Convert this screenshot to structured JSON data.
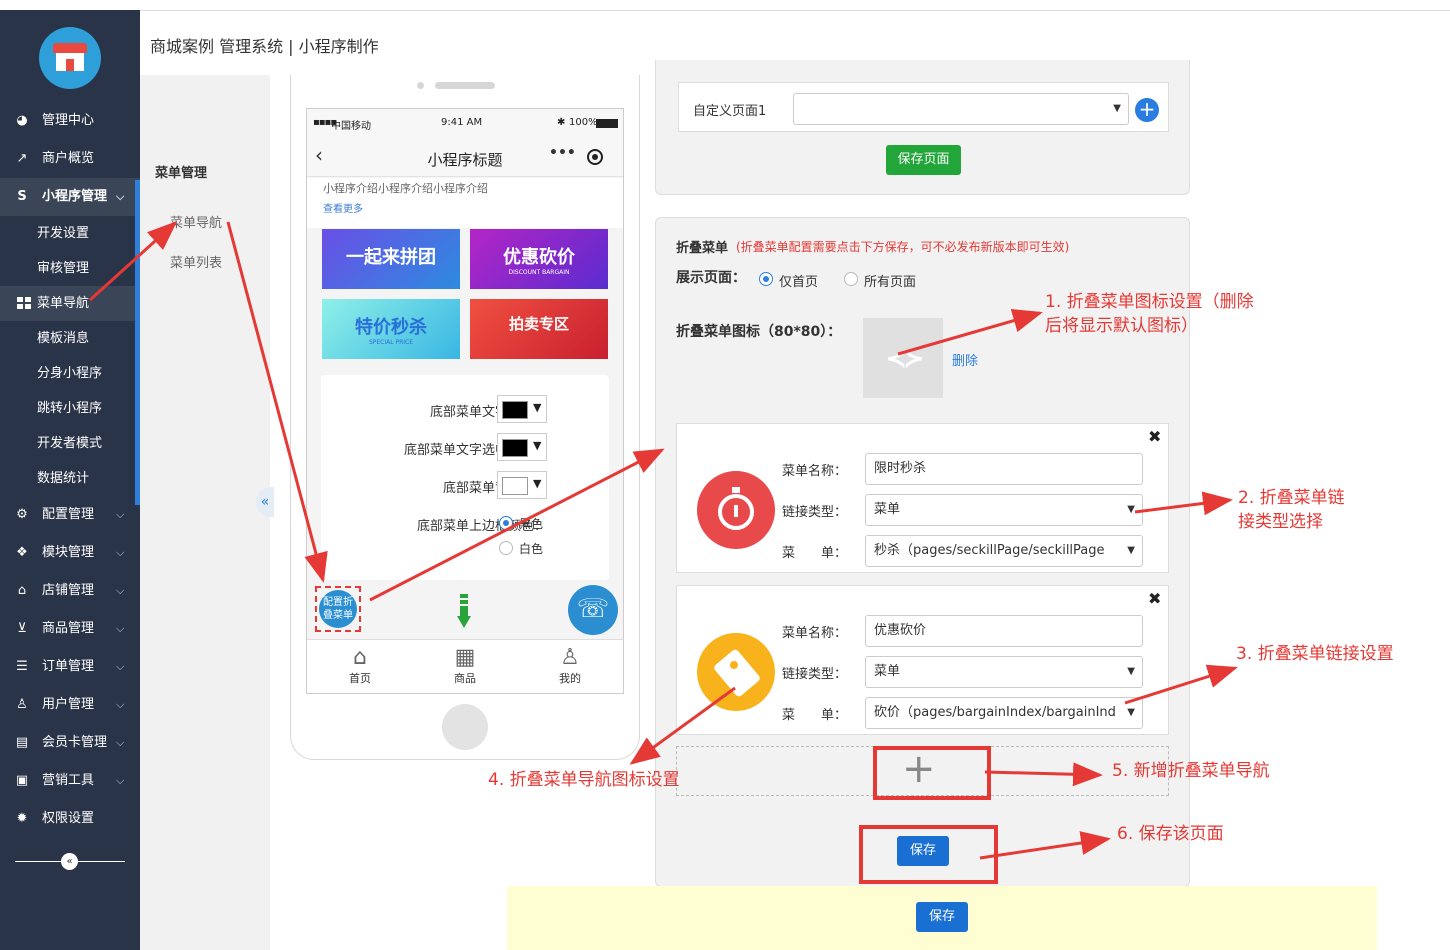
{
  "header": {
    "title": "商城案例 管理系统 | 小程序制作"
  },
  "sidebar": {
    "items": [
      {
        "label": "管理中心",
        "icon": "dashboard-icon",
        "glyph": "◕"
      },
      {
        "label": "商户概览",
        "icon": "chart-icon",
        "glyph": "↗"
      },
      {
        "label": "小程序管理",
        "icon": "dollar-icon",
        "glyph": "S",
        "expanded": true
      },
      {
        "label": "配置管理",
        "icon": "gears-icon",
        "glyph": "⚙"
      },
      {
        "label": "模块管理",
        "icon": "cubes-icon",
        "glyph": "❖"
      },
      {
        "label": "店铺管理",
        "icon": "bank-icon",
        "glyph": "⌂"
      },
      {
        "label": "商品管理",
        "icon": "cart-icon",
        "glyph": "⊻"
      },
      {
        "label": "订单管理",
        "icon": "list-icon",
        "glyph": "☰"
      },
      {
        "label": "用户管理",
        "icon": "user-icon",
        "glyph": "♙"
      },
      {
        "label": "会员卡管理",
        "icon": "card-icon",
        "glyph": "▤"
      },
      {
        "label": "营销工具",
        "icon": "briefcase-icon",
        "glyph": "▣"
      },
      {
        "label": "权限设置",
        "icon": "cog-icon",
        "glyph": "✹"
      }
    ],
    "subitems": [
      "开发设置",
      "审核管理",
      "菜单导航",
      "模板消息",
      "分身小程序",
      "跳转小程序",
      "开发者模式",
      "数据统计"
    ],
    "active_subitem": "菜单导航"
  },
  "subnav": {
    "title": "菜单管理",
    "items": [
      "菜单导航",
      "菜单列表"
    ]
  },
  "phone": {
    "carrier": "中国移动",
    "time": "9:41 AM",
    "battery": "100%",
    "title": "小程序标题",
    "intro": "小程序介绍小程序介绍小程序介绍",
    "more": "查看更多",
    "banners": [
      {
        "text": "一起来拼团",
        "sub": "",
        "color": "#4a5fd8"
      },
      {
        "text": "优惠砍价",
        "sub": "DISCOUNT BARGAIN",
        "color": "#7a2bd0"
      },
      {
        "text": "特价秒杀",
        "sub": "SPECIAL PRICE",
        "color": "#3cc6d8"
      },
      {
        "text": "拍卖专区",
        "sub": "",
        "color": "#e0393b"
      }
    ],
    "color_rows": [
      {
        "label": "底部菜单文字颜色：",
        "color": "#000000"
      },
      {
        "label": "底部菜单文字选中颜色：",
        "color": "#000000"
      },
      {
        "label": "底部菜单背景色：",
        "color": "#ffffff"
      }
    ],
    "border_label": "底部菜单上边框颜色：",
    "border_options": [
      "黑色",
      "白色"
    ],
    "fold_button": "配置折叠菜单",
    "tabs": [
      "首页",
      "商品",
      "我的"
    ]
  },
  "custom_page": {
    "label": "自定义页面1",
    "value": "",
    "save_label": "保存页面"
  },
  "fold_menu": {
    "title": "折叠菜单",
    "note": "(折叠菜单配置需要点击下方保存，可不必发布新版本即可生效)",
    "display_label": "展示页面：",
    "display_options": [
      "仅首页",
      "所有页面"
    ],
    "display_selected": "仅首页",
    "icon_label": "折叠菜单图标（80*80）：",
    "delete_label": "删除",
    "items": [
      {
        "name_label": "菜单名称：",
        "name": "限时秒杀",
        "type_label": "链接类型：",
        "type": "菜单",
        "menu_label": "菜　　单：",
        "menu": "秒杀（pages/seckillPage/seckillPage",
        "icon_color": "#e84a4a"
      },
      {
        "name_label": "菜单名称：",
        "name": "优惠砍价",
        "type_label": "链接类型：",
        "type": "菜单",
        "menu_label": "菜　　单：",
        "menu": "砍价（pages/bargainIndex/bargainInd",
        "icon_color": "#f7b21c"
      }
    ],
    "save_label": "保存"
  },
  "footer": {
    "save_label": "保存"
  },
  "annotations": [
    "1.  折叠菜单图标设置（删除",
    "后将显示默认图标）",
    "2.  折叠菜单链",
    "接类型选择",
    "3.  折叠菜单链接设置",
    "4.  折叠菜单导航图标设置",
    "5.  新增折叠菜单导航",
    "6.  保存该页面"
  ],
  "colors": {
    "sidebar": "#2a3448",
    "accent": "#1a6fd3",
    "annotation": "#e53935",
    "green": "#22a63a"
  }
}
